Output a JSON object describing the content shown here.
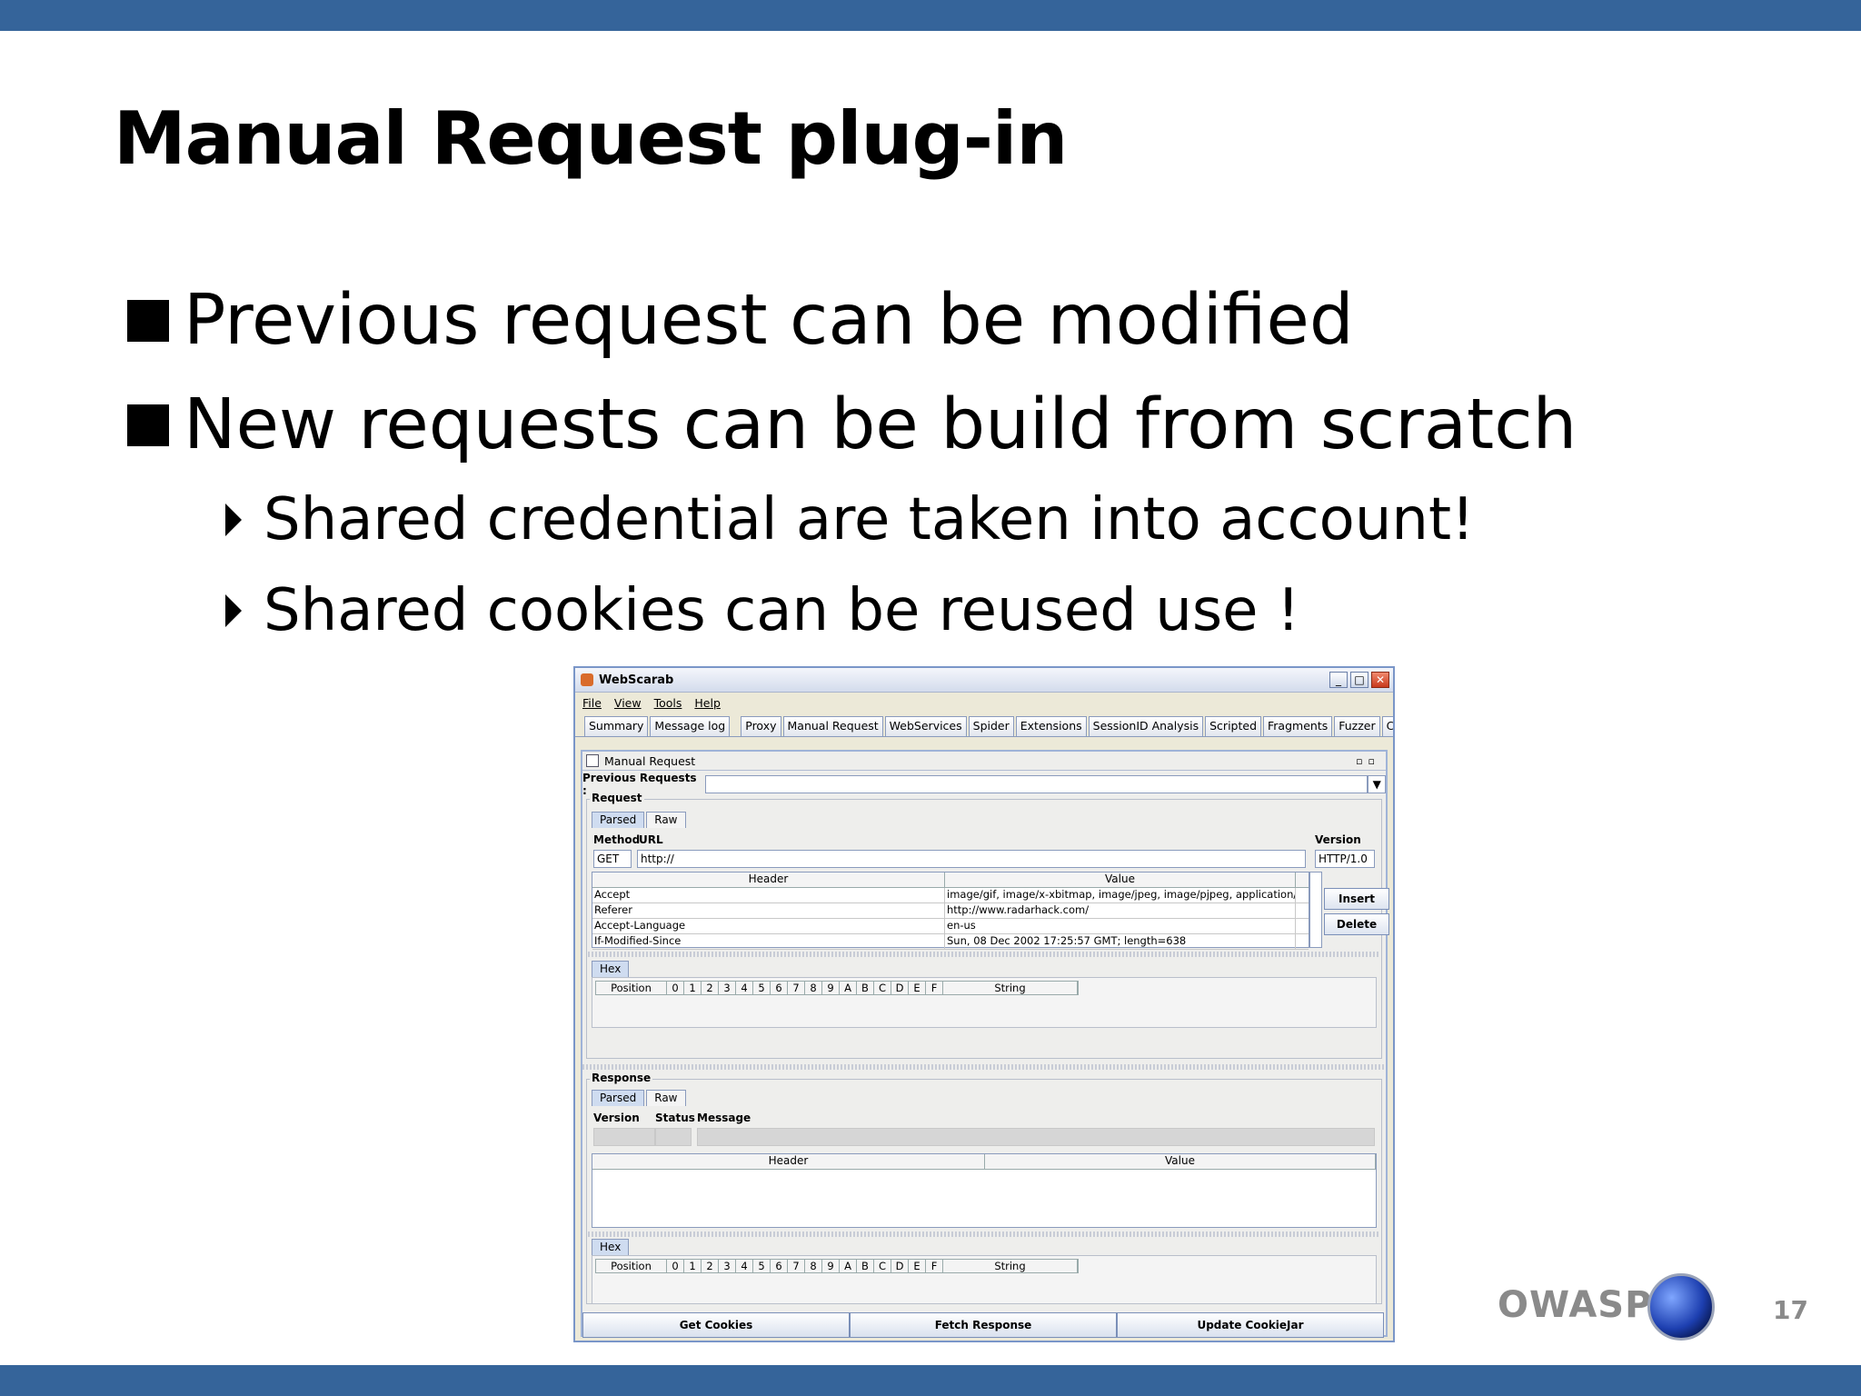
{
  "slide": {
    "title": "Manual Request plug-in",
    "bullets": [
      "Previous request can be modified",
      "New requests can be build from scratch"
    ],
    "sub_bullets": [
      "Shared credential are taken into account!",
      "Shared cookies can be reused use !"
    ],
    "footer_brand": "OWASP",
    "page_number": "17"
  },
  "window": {
    "title": "WebScarab",
    "menu": [
      "File",
      "View",
      "Tools",
      "Help"
    ],
    "tabs": [
      "Summary",
      "Message log",
      "Proxy",
      "Manual Request",
      "WebServices",
      "Spider",
      "Extensions",
      "SessionID Analysis",
      "Scripted",
      "Fragments",
      "Fuzzer",
      "Co"
    ],
    "panel_title": "Manual Request",
    "previous_requests_label": "Previous Requests :",
    "request": {
      "label": "Request",
      "tabs": [
        "Parsed",
        "Raw"
      ],
      "method_label": "Method",
      "url_label": "URL",
      "version_label": "Version",
      "method": "GET",
      "url": "http://",
      "version": "HTTP/1.0",
      "header_col": "Header",
      "value_col": "Value",
      "headers": [
        {
          "name": "Accept",
          "value": "image/gif, image/x-xbitmap, image/jpeg, image/pjpeg, application/..."
        },
        {
          "name": "Referer",
          "value": "http://www.radarhack.com/"
        },
        {
          "name": "Accept-Language",
          "value": "en-us"
        },
        {
          "name": "If-Modified-Since",
          "value": "Sun, 08 Dec 2002 17:25:57 GMT; length=638"
        }
      ],
      "insert_label": "Insert",
      "delete_label": "Delete",
      "hex_tab": "Hex"
    },
    "hex_columns": [
      "Position",
      "0",
      "1",
      "2",
      "3",
      "4",
      "5",
      "6",
      "7",
      "8",
      "9",
      "A",
      "B",
      "C",
      "D",
      "E",
      "F",
      "String"
    ],
    "response": {
      "label": "Response",
      "tabs": [
        "Parsed",
        "Raw"
      ],
      "version_label": "Version",
      "status_label": "Status",
      "message_label": "Message",
      "header_col": "Header",
      "value_col": "Value",
      "hex_tab": "Hex"
    },
    "buttons": {
      "get_cookies": "Get Cookies",
      "fetch_response": "Fetch Response",
      "update_cookiejar": "Update CookieJar"
    }
  }
}
